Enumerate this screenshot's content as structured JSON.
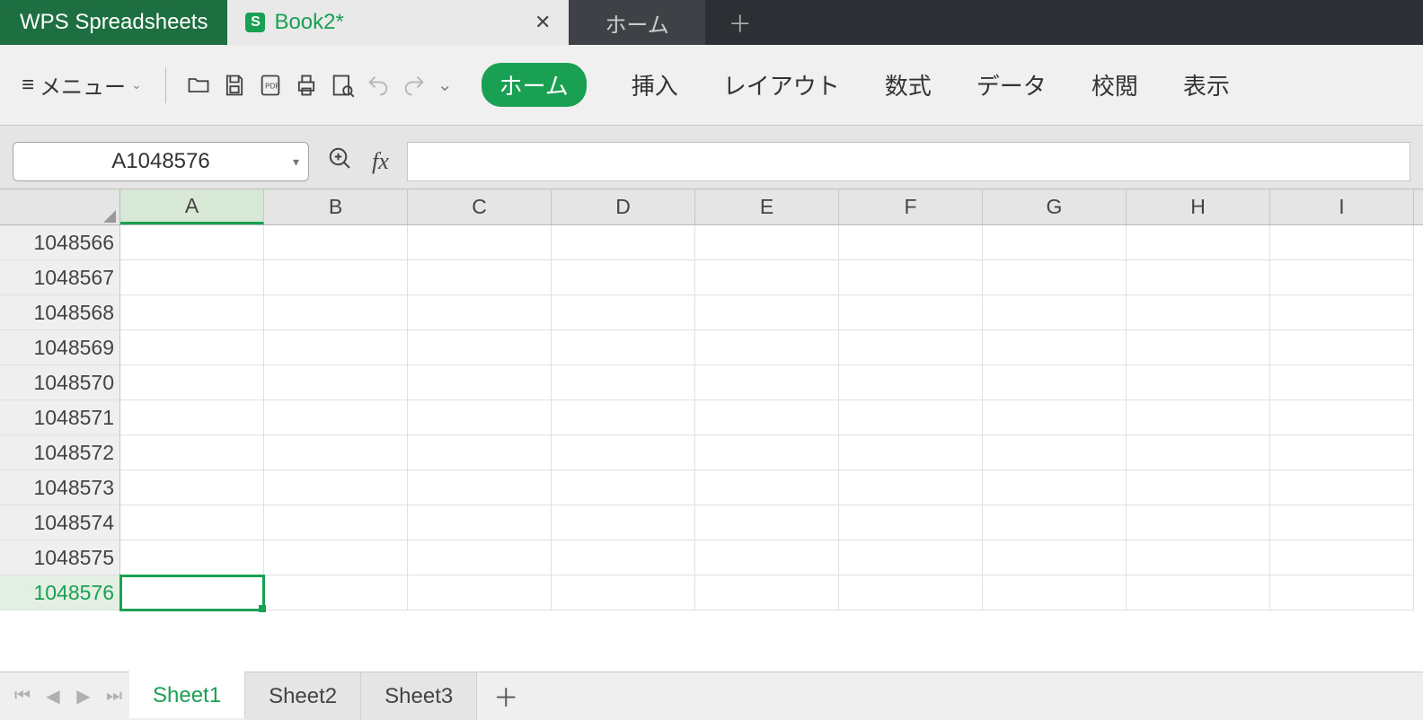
{
  "titlebar": {
    "app_name": "WPS Spreadsheets",
    "doc_name": "Book2*",
    "home_tab_label": "ホーム"
  },
  "ribbon": {
    "menu_label": "メニュー",
    "tabs": {
      "home": "ホーム",
      "insert": "挿入",
      "layout": "レイアウト",
      "formulas": "数式",
      "data": "データ",
      "review": "校閲",
      "view": "表示"
    }
  },
  "formula_bar": {
    "name_box": "A1048576",
    "fx_label": "fx",
    "formula_value": ""
  },
  "grid": {
    "columns": [
      "A",
      "B",
      "C",
      "D",
      "E",
      "F",
      "G",
      "H",
      "I"
    ],
    "rows": [
      "1048566",
      "1048567",
      "1048568",
      "1048569",
      "1048570",
      "1048571",
      "1048572",
      "1048573",
      "1048574",
      "1048575",
      "1048576"
    ],
    "selected_col": "A",
    "selected_row": "1048576"
  },
  "sheetbar": {
    "tabs": [
      {
        "name": "Sheet1",
        "active": true
      },
      {
        "name": "Sheet2",
        "active": false
      },
      {
        "name": "Sheet3",
        "active": false
      }
    ]
  }
}
